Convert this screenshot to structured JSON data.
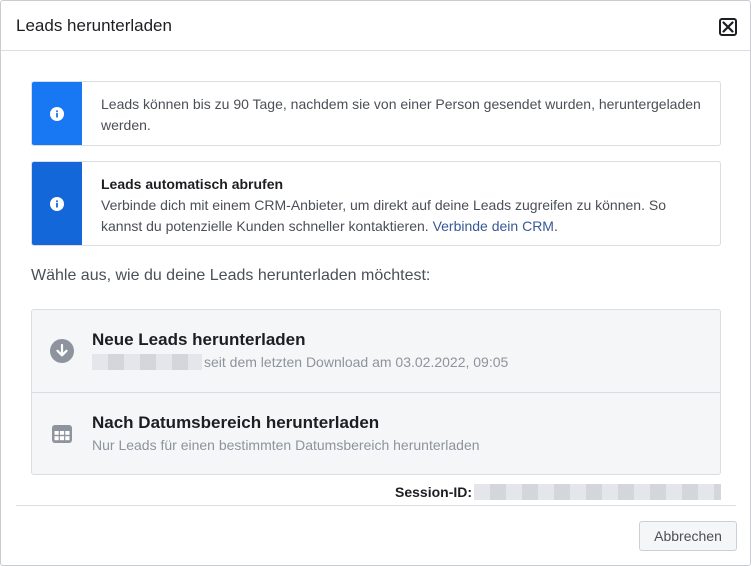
{
  "dialog": {
    "title": "Leads herunterladen"
  },
  "notices": [
    {
      "text": "Leads können bis zu 90 Tage, nachdem sie von einer Person gesendet wurden, heruntergeladen werden."
    },
    {
      "heading": "Leads automatisch abrufen",
      "text": "Verbinde dich mit einem CRM-Anbieter, um direkt auf deine Leads zugreifen zu können. So kannst du potenzielle Kunden schneller kontaktieren.",
      "link": "Verbinde dein CRM",
      "link_suffix": "."
    }
  ],
  "prompt": "Wähle aus, wie du deine Leads herunterladen möchtest:",
  "options": [
    {
      "title": "Neue Leads herunterladen",
      "subtitle": "seit dem letzten Download am 03.02.2022, 09:05"
    },
    {
      "title": "Nach Datumsbereich herunterladen",
      "subtitle": "Nur Leads für einen bestimmten Datumsbereich herunterladen"
    }
  ],
  "session": {
    "label": "Session-ID:"
  },
  "footer": {
    "cancel_label": "Abbrechen"
  },
  "colors": {
    "accent": "#1877f2",
    "link": "#385898"
  }
}
